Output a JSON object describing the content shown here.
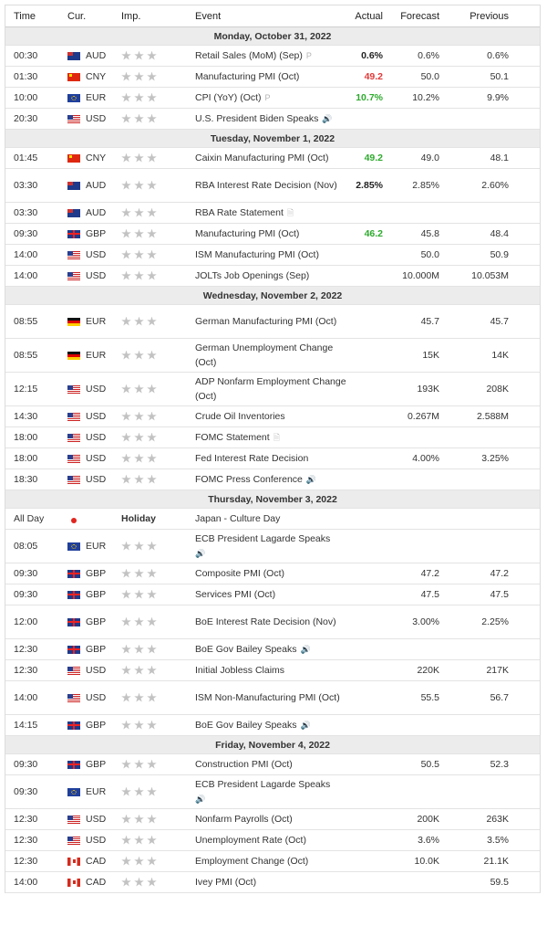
{
  "header": {
    "time": "Time",
    "cur": "Cur.",
    "imp": "Imp.",
    "event": "Event",
    "actual": "Actual",
    "forecast": "Forecast",
    "previous": "Previous"
  },
  "colors": {
    "up": "#2eaa2e",
    "down": "#e03a3a",
    "neutral": "#222222"
  },
  "days": [
    {
      "date": "Monday, October 31, 2022",
      "events": [
        {
          "time": "00:30",
          "flag": "AU",
          "cur": "AUD",
          "event": "Retail Sales (MoM) (Sep)",
          "icon": "preliminary-icon",
          "actual": "0.6%",
          "astatus": "neu",
          "forecast": "0.6%",
          "previous": "0.6%"
        },
        {
          "time": "01:30",
          "flag": "CN",
          "cur": "CNY",
          "event": "Manufacturing PMI (Oct)",
          "actual": "49.2",
          "astatus": "down",
          "forecast": "50.0",
          "previous": "50.1"
        },
        {
          "time": "10:00",
          "flag": "EU",
          "cur": "EUR",
          "event": "CPI (YoY) (Oct)",
          "icon": "preliminary-icon",
          "actual": "10.7%",
          "astatus": "up",
          "forecast": "10.2%",
          "previous": "9.9%"
        },
        {
          "time": "20:30",
          "flag": "US",
          "cur": "USD",
          "event": "U.S. President Biden Speaks",
          "icon": "speaker-icon",
          "actual": "",
          "forecast": "",
          "previous": ""
        }
      ]
    },
    {
      "date": "Tuesday, November 1, 2022",
      "events": [
        {
          "time": "01:45",
          "flag": "CN",
          "cur": "CNY",
          "event": "Caixin Manufacturing PMI (Oct)",
          "actual": "49.2",
          "astatus": "up",
          "forecast": "49.0",
          "previous": "48.1"
        },
        {
          "time": "03:30",
          "flag": "AU",
          "cur": "AUD",
          "event": "RBA Interest Rate Decision (Nov)",
          "actual": "2.85%",
          "astatus": "neu",
          "forecast": "2.85%",
          "previous": "2.60%",
          "tall": true
        },
        {
          "time": "03:30",
          "flag": "AU",
          "cur": "AUD",
          "event": "RBA Rate Statement",
          "icon": "document-icon",
          "actual": "",
          "forecast": "",
          "previous": ""
        },
        {
          "time": "09:30",
          "flag": "GB",
          "cur": "GBP",
          "event": "Manufacturing PMI (Oct)",
          "actual": "46.2",
          "astatus": "up",
          "forecast": "45.8",
          "previous": "48.4"
        },
        {
          "time": "14:00",
          "flag": "US",
          "cur": "USD",
          "event": "ISM Manufacturing PMI (Oct)",
          "actual": "",
          "forecast": "50.0",
          "previous": "50.9"
        },
        {
          "time": "14:00",
          "flag": "US",
          "cur": "USD",
          "event": "JOLTs Job Openings (Sep)",
          "actual": "",
          "forecast": "10.000M",
          "previous": "10.053M"
        }
      ]
    },
    {
      "date": "Wednesday, November 2, 2022",
      "events": [
        {
          "time": "08:55",
          "flag": "DE",
          "cur": "EUR",
          "event": "German Manufacturing PMI (Oct)",
          "actual": "",
          "forecast": "45.7",
          "previous": "45.7",
          "tall": true
        },
        {
          "time": "08:55",
          "flag": "DE",
          "cur": "EUR",
          "event": "German Unemployment Change (Oct)",
          "actual": "",
          "forecast": "15K",
          "previous": "14K",
          "tall": true
        },
        {
          "time": "12:15",
          "flag": "US",
          "cur": "USD",
          "event": "ADP Nonfarm Employment Change (Oct)",
          "actual": "",
          "forecast": "193K",
          "previous": "208K",
          "tall": true
        },
        {
          "time": "14:30",
          "flag": "US",
          "cur": "USD",
          "event": "Crude Oil Inventories",
          "actual": "",
          "forecast": "0.267M",
          "previous": "2.588M"
        },
        {
          "time": "18:00",
          "flag": "US",
          "cur": "USD",
          "event": "FOMC Statement",
          "icon": "document-icon",
          "actual": "",
          "forecast": "",
          "previous": ""
        },
        {
          "time": "18:00",
          "flag": "US",
          "cur": "USD",
          "event": "Fed Interest Rate Decision",
          "actual": "",
          "forecast": "4.00%",
          "previous": "3.25%"
        },
        {
          "time": "18:30",
          "flag": "US",
          "cur": "USD",
          "event": "FOMC Press Conference",
          "icon": "speaker-icon",
          "actual": "",
          "forecast": "",
          "previous": ""
        }
      ]
    },
    {
      "date": "Thursday, November 3, 2022",
      "events": [
        {
          "time": "All Day",
          "flag": "JP",
          "cur": "",
          "holiday": "Holiday",
          "event": "Japan - Culture Day",
          "actual": "",
          "forecast": "",
          "previous": ""
        },
        {
          "time": "08:05",
          "flag": "EU",
          "cur": "EUR",
          "event": "ECB President Lagarde Speaks",
          "icon": "speaker-icon",
          "iconBelow": true,
          "actual": "",
          "forecast": "",
          "previous": "",
          "tall": true
        },
        {
          "time": "09:30",
          "flag": "GB",
          "cur": "GBP",
          "event": "Composite PMI (Oct)",
          "actual": "",
          "forecast": "47.2",
          "previous": "47.2"
        },
        {
          "time": "09:30",
          "flag": "GB",
          "cur": "GBP",
          "event": "Services PMI (Oct)",
          "actual": "",
          "forecast": "47.5",
          "previous": "47.5"
        },
        {
          "time": "12:00",
          "flag": "GB",
          "cur": "GBP",
          "event": "BoE Interest Rate Decision (Nov)",
          "actual": "",
          "forecast": "3.00%",
          "previous": "2.25%",
          "tall": true
        },
        {
          "time": "12:30",
          "flag": "GB",
          "cur": "GBP",
          "event": "BoE Gov Bailey Speaks",
          "icon": "speaker-icon",
          "actual": "",
          "forecast": "",
          "previous": ""
        },
        {
          "time": "12:30",
          "flag": "US",
          "cur": "USD",
          "event": "Initial Jobless Claims",
          "actual": "",
          "forecast": "220K",
          "previous": "217K"
        },
        {
          "time": "14:00",
          "flag": "US",
          "cur": "USD",
          "event": "ISM Non-Manufacturing PMI (Oct)",
          "actual": "",
          "forecast": "55.5",
          "previous": "56.7",
          "tall": true
        },
        {
          "time": "14:15",
          "flag": "GB",
          "cur": "GBP",
          "event": "BoE Gov Bailey Speaks",
          "icon": "speaker-icon",
          "actual": "",
          "forecast": "",
          "previous": ""
        }
      ]
    },
    {
      "date": "Friday, November 4, 2022",
      "events": [
        {
          "time": "09:30",
          "flag": "GB",
          "cur": "GBP",
          "event": "Construction PMI (Oct)",
          "actual": "",
          "forecast": "50.5",
          "previous": "52.3"
        },
        {
          "time": "09:30",
          "flag": "EU",
          "cur": "EUR",
          "event": "ECB President Lagarde Speaks",
          "icon": "speaker-icon",
          "iconBelow": true,
          "actual": "",
          "forecast": "",
          "previous": "",
          "tall": true
        },
        {
          "time": "12:30",
          "flag": "US",
          "cur": "USD",
          "event": "Nonfarm Payrolls (Oct)",
          "actual": "",
          "forecast": "200K",
          "previous": "263K"
        },
        {
          "time": "12:30",
          "flag": "US",
          "cur": "USD",
          "event": "Unemployment Rate (Oct)",
          "actual": "",
          "forecast": "3.6%",
          "previous": "3.5%"
        },
        {
          "time": "12:30",
          "flag": "CA",
          "cur": "CAD",
          "event": "Employment Change (Oct)",
          "actual": "",
          "forecast": "10.0K",
          "previous": "21.1K"
        },
        {
          "time": "14:00",
          "flag": "CA",
          "cur": "CAD",
          "event": "Ivey PMI (Oct)",
          "actual": "",
          "forecast": "",
          "previous": "59.5"
        }
      ]
    }
  ]
}
